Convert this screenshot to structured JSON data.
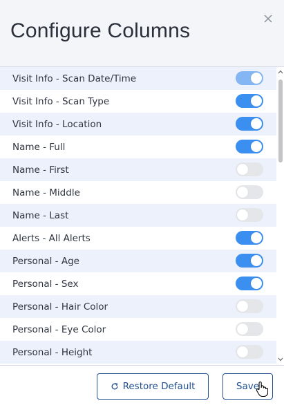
{
  "dialog": {
    "title": "Configure Columns",
    "close_icon": "close-icon"
  },
  "columns": [
    {
      "label": "Visit Info - Scan Date/Time",
      "enabled": true,
      "disabled_control": true
    },
    {
      "label": "Visit Info - Scan Type",
      "enabled": true
    },
    {
      "label": "Visit Info - Location",
      "enabled": true
    },
    {
      "label": "Name - Full",
      "enabled": true
    },
    {
      "label": "Name - First",
      "enabled": false
    },
    {
      "label": "Name - Middle",
      "enabled": false
    },
    {
      "label": "Name - Last",
      "enabled": false
    },
    {
      "label": "Alerts - All Alerts",
      "enabled": true
    },
    {
      "label": "Personal - Age",
      "enabled": true
    },
    {
      "label": "Personal - Sex",
      "enabled": true
    },
    {
      "label": "Personal - Hair Color",
      "enabled": false
    },
    {
      "label": "Personal - Eye Color",
      "enabled": false
    },
    {
      "label": "Personal - Height",
      "enabled": false
    }
  ],
  "footer": {
    "restore_label": "Restore Default",
    "restore_icon": "refresh-icon",
    "save_label": "Save"
  },
  "colors": {
    "toggle_on": "#3b8ff0",
    "toggle_off": "#e4e6ea",
    "row_alt": "#edf1fb",
    "button_border": "#1f4f8f"
  }
}
